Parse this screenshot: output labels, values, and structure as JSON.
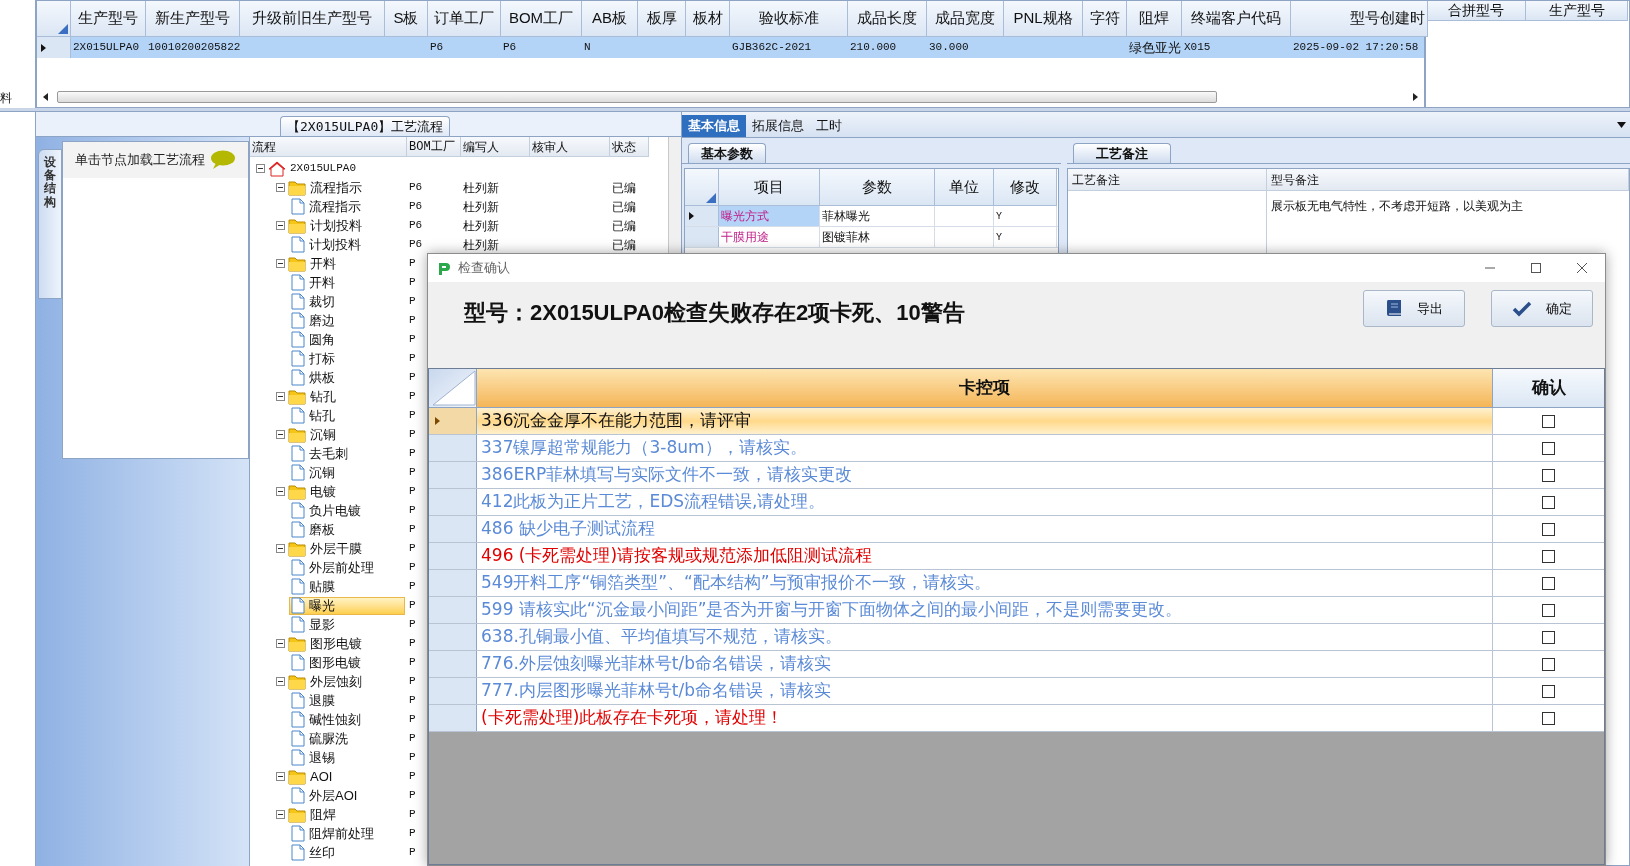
{
  "left_edge": {
    "text": "料"
  },
  "main_grid": {
    "columns": [
      {
        "label": "生产型号",
        "value": "2X015ULPA0"
      },
      {
        "label": "新生产型号",
        "value": "10010200205822"
      },
      {
        "label": "升级前旧生产型号"
      },
      {
        "label": "S板"
      },
      {
        "label": "订单工厂",
        "value": "P6"
      },
      {
        "label": "BOM工厂",
        "value": "P6"
      },
      {
        "label": "AB板",
        "value": "N"
      },
      {
        "label": "板厚"
      },
      {
        "label": "板材"
      },
      {
        "label": "验收标准",
        "value": "GJB362C-2021"
      },
      {
        "label": "成品长度",
        "value": "210.000"
      },
      {
        "label": "成品宽度",
        "value": "30.000"
      },
      {
        "label": "PNL规格"
      },
      {
        "label": "字符"
      },
      {
        "label": "阻焊",
        "value": "绿色亚光"
      },
      {
        "label": "终端客户代码",
        "value": "X015"
      },
      {
        "label": "型号创建时",
        "value": "2025-09-02 17:20:58"
      }
    ],
    "row_selected": true
  },
  "merge_grid": {
    "columns": [
      "合拼型号",
      "生产型号"
    ]
  },
  "left_panel": {
    "vertical_tab": "设备结构",
    "hint": "单击节点加载工艺流程"
  },
  "flow_tab": "【2X015ULPA0】工艺流程",
  "flow_tree": {
    "columns": [
      "流程",
      "BOM工厂",
      "编写人",
      "核审人",
      "状态"
    ],
    "root": {
      "label": "2X015ULPA0",
      "expanded": true,
      "children": [
        {
          "label": "流程指示",
          "expanded": true,
          "bom": "P6",
          "writer": "杜列新",
          "status": "已编",
          "children": [
            {
              "label": "流程指示",
              "bom": "P6",
              "writer": "杜列新",
              "status": "已编",
              "selected": false
            }
          ]
        },
        {
          "label": "计划投料",
          "expanded": true,
          "bom": "P6",
          "writer": "杜列新",
          "status": "已编",
          "children": [
            {
              "label": "计划投料",
              "bom": "P6",
              "writer": "杜列新",
              "status": "已编",
              "selected": false
            }
          ]
        },
        {
          "label": "开料",
          "expanded": true,
          "bom": "P",
          "children": [
            {
              "label": "开料",
              "bom": "P",
              "selected": false
            },
            {
              "label": "裁切",
              "bom": "P",
              "selected": false
            },
            {
              "label": "磨边",
              "bom": "P",
              "selected": false
            },
            {
              "label": "圆角",
              "bom": "P",
              "selected": false
            },
            {
              "label": "打标",
              "bom": "P",
              "selected": false
            },
            {
              "label": "烘板",
              "bom": "P",
              "selected": false
            }
          ]
        },
        {
          "label": "钻孔",
          "expanded": true,
          "bom": "P",
          "children": [
            {
              "label": "钻孔",
              "bom": "P",
              "selected": false
            }
          ]
        },
        {
          "label": "沉铜",
          "expanded": true,
          "bom": "P",
          "children": [
            {
              "label": "去毛刺",
              "bom": "P",
              "selected": false
            },
            {
              "label": "沉铜",
              "bom": "P",
              "selected": false
            }
          ]
        },
        {
          "label": "电镀",
          "expanded": true,
          "bom": "P",
          "children": [
            {
              "label": "负片电镀",
              "bom": "P",
              "selected": false
            },
            {
              "label": "磨板",
              "bom": "P",
              "selected": false
            }
          ]
        },
        {
          "label": "外层干膜",
          "expanded": true,
          "bom": "P",
          "children": [
            {
              "label": "外层前处理",
              "bom": "P",
              "selected": false
            },
            {
              "label": "贴膜",
              "bom": "P",
              "selected": false
            },
            {
              "label": "曝光",
              "bom": "P",
              "selected": true
            },
            {
              "label": "显影",
              "bom": "P",
              "selected": false
            }
          ]
        },
        {
          "label": "图形电镀",
          "expanded": true,
          "bom": "P",
          "children": [
            {
              "label": "图形电镀",
              "bom": "P",
              "selected": false
            }
          ]
        },
        {
          "label": "外层蚀刻",
          "expanded": true,
          "bom": "P",
          "children": [
            {
              "label": "退膜",
              "bom": "P",
              "selected": false
            },
            {
              "label": "碱性蚀刻",
              "bom": "P",
              "selected": false
            },
            {
              "label": "硫脲洗",
              "bom": "P",
              "selected": false
            },
            {
              "label": "退锡",
              "bom": "P",
              "selected": false
            }
          ]
        },
        {
          "label": "AOI",
          "expanded": true,
          "bom": "P",
          "children": [
            {
              "label": "外层AOI",
              "bom": "P",
              "selected": false
            }
          ]
        },
        {
          "label": "阻焊",
          "expanded": true,
          "bom": "P",
          "children": [
            {
              "label": "阻焊前处理",
              "bom": "P",
              "selected": false
            },
            {
              "label": "丝印",
              "bom": "P",
              "selected": false
            }
          ]
        }
      ]
    }
  },
  "info_tabs": [
    {
      "label": "基本信息",
      "selected": true
    },
    {
      "label": "拓展信息",
      "selected": false
    },
    {
      "label": "工时",
      "selected": false
    }
  ],
  "basic_params": {
    "tab": "基本参数",
    "columns": [
      "项目",
      "参数",
      "单位",
      "修改"
    ],
    "rows": [
      {
        "item": "曝光方式",
        "param": "菲林曝光",
        "modified": "Y",
        "selected": true
      },
      {
        "item": "干膜用途",
        "param": "图镀菲林",
        "modified": "Y",
        "selected": false
      }
    ]
  },
  "process_notes": {
    "tab": "工艺备注",
    "columns": [
      "工艺备注",
      "型号备注"
    ],
    "model_note": "展示板无电气特性，不考虑开短路，以美观为主"
  },
  "dialog": {
    "title": "检查确认",
    "heading": "型号：2X015ULPA0检查失败存在2项卡死、10警告",
    "buttons": [
      {
        "kind": "export",
        "label": "导出"
      },
      {
        "kind": "confirm",
        "label": "确定"
      }
    ],
    "columns": [
      "卡控项",
      "确认"
    ],
    "rows": [
      {
        "text": "336沉金金厚不在能力范围，请评审",
        "kind": "notice",
        "selected": true,
        "checked": false
      },
      {
        "text": "337镍厚超常规能力（3-8um），请核实。",
        "kind": "warning",
        "selected": false,
        "checked": false
      },
      {
        "text": "386ERP菲林填写与实际文件不一致，请核实更改",
        "kind": "warning",
        "selected": false,
        "checked": false
      },
      {
        "text": "412此板为正片工艺，EDS流程错误,请处理。",
        "kind": "warning",
        "selected": false,
        "checked": false
      },
      {
        "text": "486 缺少电子测试流程",
        "kind": "warning",
        "selected": false,
        "checked": false
      },
      {
        "text": "496 (卡死需处理)请按客规或规范添加低阻测试流程",
        "kind": "blocker",
        "selected": false,
        "checked": false
      },
      {
        "text": "549开料工序“铜箔类型”、“配本结构”与预审报价不一致，请核实。",
        "kind": "warning",
        "selected": false,
        "checked": false
      },
      {
        "text": "599 请核实此“沉金最小间距”是否为开窗与开窗下面物体之间的最小间距，不是则需要更改。",
        "kind": "warning",
        "selected": false,
        "checked": false
      },
      {
        "text": "638.孔铜最小值、平均值填写不规范，请核实。",
        "kind": "warning",
        "selected": false,
        "checked": false
      },
      {
        "text": "776.外层蚀刻曝光菲林号t/b命名错误，请核实",
        "kind": "warning",
        "selected": false,
        "checked": false
      },
      {
        "text": "777.内层图形曝光菲林号t/b命名错误，请核实",
        "kind": "warning",
        "selected": false,
        "checked": false
      },
      {
        "text": "(卡死需处理)此板存在卡死项，请处理！",
        "kind": "blocker",
        "selected": false,
        "checked": false
      }
    ]
  }
}
